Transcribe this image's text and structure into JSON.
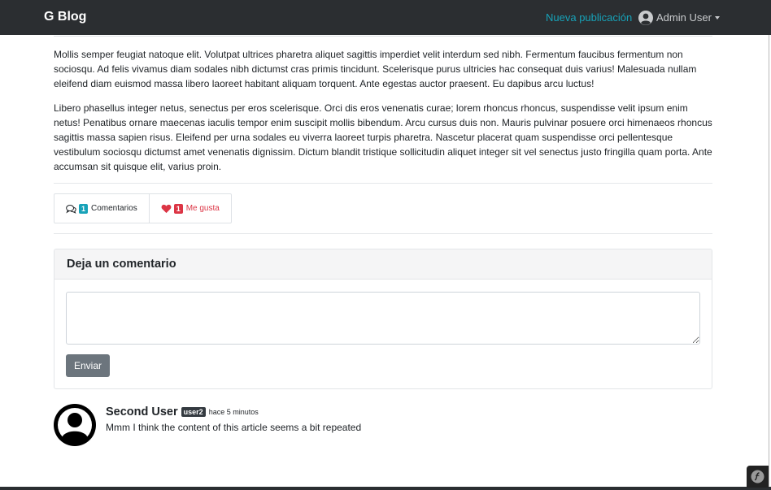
{
  "navbar": {
    "brand": "G Blog",
    "new_post": "Nueva publicación",
    "user_name": "Admin User",
    "user_icon": "user-circle-icon",
    "dropdown_icon": "caret-down-icon"
  },
  "article": {
    "paragraphs": [
      "Mollis semper feugiat natoque elit. Volutpat ultrices pharetra aliquet sagittis imperdiet velit interdum sed nibh. Fermentum faucibus fermentum non sociosqu. Ad felis vivamus diam sodales nibh dictumst cras primis tincidunt. Scelerisque purus ultricies hac consequat duis varius! Malesuada nullam eleifend diam euismod massa libero laoreet habitant aliquam torquent. Ante egestas auctor praesent. Eu dapibus arcu luctus!",
      "Libero phasellus integer netus, senectus per eros scelerisque. Orci dis eros venenatis curae; lorem rhoncus rhoncus, suspendisse velit ipsum enim netus! Penatibus ornare maecenas iaculis tempor enim suscipit mollis bibendum. Arcu cursus duis non. Mauris pulvinar posuere orci himenaeos rhoncus sagittis massa sapien risus. Eleifend per urna sodales eu viverra laoreet turpis pharetra. Nascetur placerat quam suspendisse orci pellentesque vestibulum sociosqu dictumst amet venenatis dignissim. Dictum blandit tristique sollicitudin aliquet integer sit vel senectus justo fringilla quam porta. Ante accumsan sit quisque elit, varius proin."
    ]
  },
  "actions": {
    "comments_icon": "comments-icon",
    "comments_count": "1",
    "comments_label": "Comentarios",
    "likes_icon": "heart-icon",
    "likes_count": "1",
    "likes_label": "Me gusta"
  },
  "comment_form": {
    "title": "Deja un comentario",
    "textarea_value": "",
    "submit_label": "Enviar"
  },
  "comments": [
    {
      "author": "Second User",
      "username_badge": "user2",
      "time": "hace 5 minutos",
      "text": "Mmm I think the content of this article seems a bit repeated",
      "avatar_icon": "user-avatar-icon"
    }
  ],
  "debug_toolbar": {
    "icon": "symfony-icon"
  },
  "colors": {
    "navbar_bg": "#2b2e31",
    "link_accent": "#17a2b8",
    "like_red": "#dc3545",
    "button_gray": "#6c757d"
  }
}
